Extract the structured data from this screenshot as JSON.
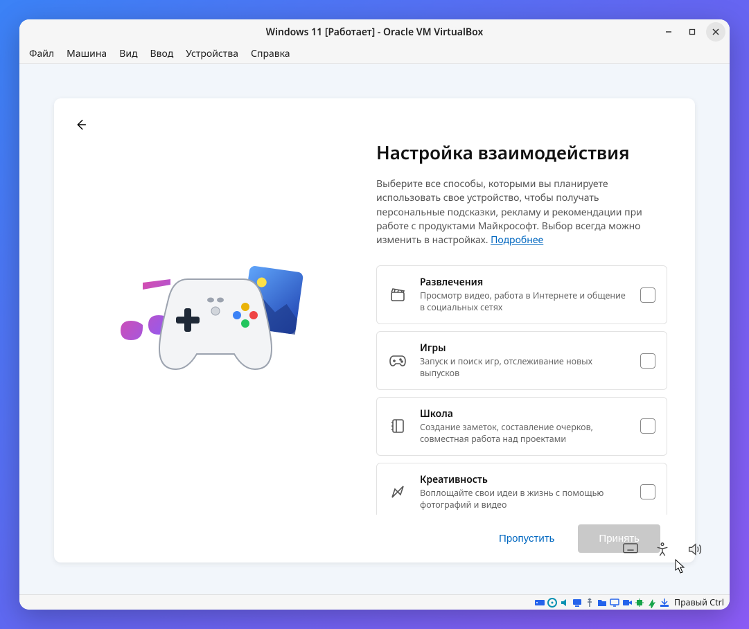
{
  "window": {
    "title": "Windows 11 [Работает] - Oracle VM VirtualBox"
  },
  "menubar": {
    "items": [
      "Файл",
      "Машина",
      "Вид",
      "Ввод",
      "Устройства",
      "Справка"
    ]
  },
  "oobe": {
    "heading": "Настройка взаимодействия",
    "subtext_prefix": "Выберите все способы, которыми вы планируете использовать свое устройство, чтобы получать персональные подсказки, рекламу и рекомендации при работе с продуктами Майкрософт. Выбор всегда можно изменить в настройках. ",
    "learn_more": "Подробнее",
    "options": [
      {
        "icon": "clapperboard",
        "title": "Развлечения",
        "desc": "Просмотр видео, работа в Интернете и общение в социальных сетях"
      },
      {
        "icon": "gamepad",
        "title": "Игры",
        "desc": "Запуск и поиск игр, отслеживание новых выпусков"
      },
      {
        "icon": "notebook",
        "title": "Школа",
        "desc": "Создание заметок, составление очерков, совместная работа над проектами"
      },
      {
        "icon": "pen-brush",
        "title": "Креативность",
        "desc": "Воплощайте свои идеи в жизнь с помощью фотографий и видео"
      }
    ],
    "skip_label": "Пропустить",
    "accept_label": "Принять"
  },
  "statusbar": {
    "host_key": "Правый Ctrl"
  }
}
